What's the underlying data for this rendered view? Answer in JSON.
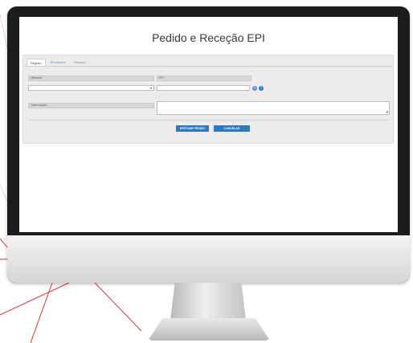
{
  "app": {
    "title": "Pedido e Receção EPI",
    "tabs": [
      {
        "label": "Registo"
      },
      {
        "label": "Pendentes"
      },
      {
        "label": "Histórico"
      }
    ],
    "form": {
      "field1_label": "Utilizador",
      "field2_label": "EPI",
      "select_value": "",
      "input_value": "",
      "observations_label": "Observações",
      "observations_value": ""
    },
    "buttons": {
      "submit": "EFETUAR PEDIDO",
      "cancel": "CANCELAR"
    }
  },
  "colors": {
    "accent": "#2f78bd",
    "monitor_frame": "#1c1c1c",
    "bg_line": "#d9373a",
    "plus_icon": "#5a8fc9",
    "info_icon": "#2f78bd"
  }
}
